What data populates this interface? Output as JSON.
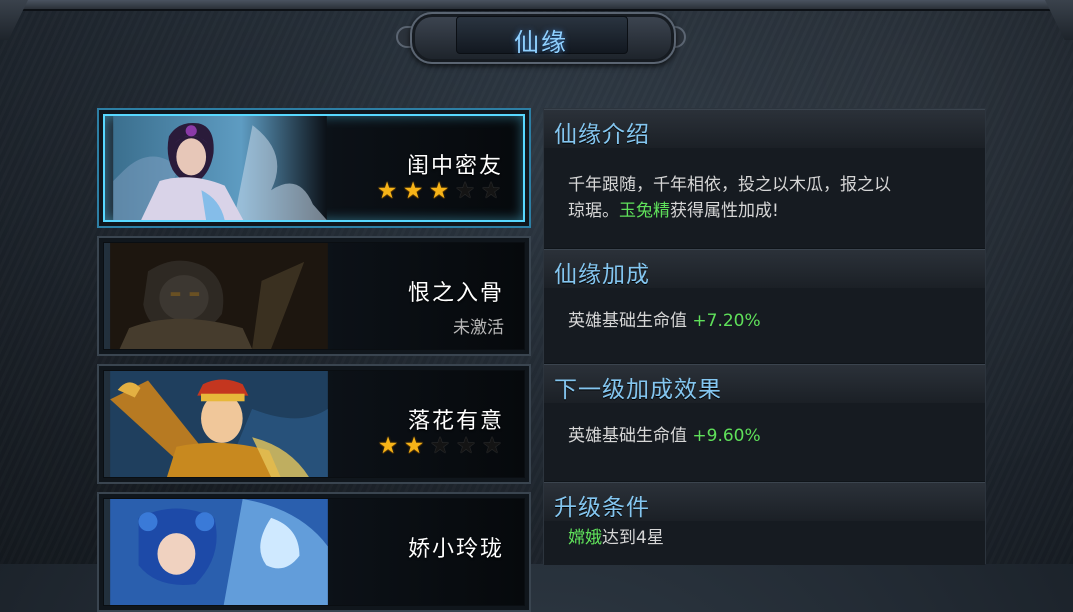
{
  "window": {
    "title": "仙缘"
  },
  "cards": [
    {
      "name": "闺中密友",
      "stars_filled": 3,
      "stars_total": 5,
      "status": "",
      "selected": true,
      "active": true
    },
    {
      "name": "恨之入骨",
      "stars_filled": 0,
      "stars_total": 5,
      "status": "未激活",
      "selected": false,
      "active": false
    },
    {
      "name": "落花有意",
      "stars_filled": 2,
      "stars_total": 5,
      "status": "",
      "selected": false,
      "active": true
    },
    {
      "name": "娇小玲珑",
      "stars_filled": 0,
      "stars_total": 5,
      "status": "",
      "selected": false,
      "active": true
    }
  ],
  "detail": {
    "intro": {
      "title": "仙缘介绍",
      "line1": "千年跟随，千年相依，投之以木瓜，报之以",
      "line2_prefix": "琼琚。",
      "hero_name": "玉兔精",
      "line2_suffix": "获得属性加成!"
    },
    "bonus": {
      "title": "仙缘加成",
      "stat_label": "英雄基础生命值",
      "stat_value": "+7.20%"
    },
    "next_bonus": {
      "title": "下一级加成效果",
      "stat_label": "英雄基础生命值",
      "stat_value": "+9.60%"
    },
    "upgrade": {
      "title": "升级条件",
      "hero_name": "嫦娥",
      "condition": "达到4星"
    }
  },
  "colors": {
    "accent_blue": "#84c6f0",
    "selection_glow": "#58d8ff",
    "star_gold": "#f7b418",
    "value_green": "#5fe05a"
  }
}
